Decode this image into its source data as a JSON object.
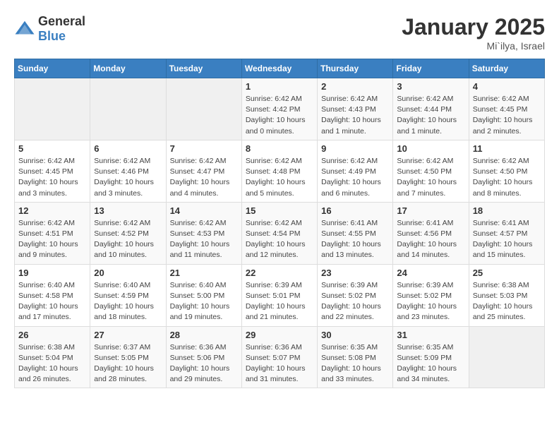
{
  "logo": {
    "general": "General",
    "blue": "Blue"
  },
  "header": {
    "title": "January 2025",
    "location": "Mi`ilya, Israel"
  },
  "weekdays": [
    "Sunday",
    "Monday",
    "Tuesday",
    "Wednesday",
    "Thursday",
    "Friday",
    "Saturday"
  ],
  "weeks": [
    [
      {
        "day": "",
        "info": ""
      },
      {
        "day": "",
        "info": ""
      },
      {
        "day": "",
        "info": ""
      },
      {
        "day": "1",
        "info": "Sunrise: 6:42 AM\nSunset: 4:42 PM\nDaylight: 10 hours\nand 0 minutes."
      },
      {
        "day": "2",
        "info": "Sunrise: 6:42 AM\nSunset: 4:43 PM\nDaylight: 10 hours\nand 1 minute."
      },
      {
        "day": "3",
        "info": "Sunrise: 6:42 AM\nSunset: 4:44 PM\nDaylight: 10 hours\nand 1 minute."
      },
      {
        "day": "4",
        "info": "Sunrise: 6:42 AM\nSunset: 4:45 PM\nDaylight: 10 hours\nand 2 minutes."
      }
    ],
    [
      {
        "day": "5",
        "info": "Sunrise: 6:42 AM\nSunset: 4:45 PM\nDaylight: 10 hours\nand 3 minutes."
      },
      {
        "day": "6",
        "info": "Sunrise: 6:42 AM\nSunset: 4:46 PM\nDaylight: 10 hours\nand 3 minutes."
      },
      {
        "day": "7",
        "info": "Sunrise: 6:42 AM\nSunset: 4:47 PM\nDaylight: 10 hours\nand 4 minutes."
      },
      {
        "day": "8",
        "info": "Sunrise: 6:42 AM\nSunset: 4:48 PM\nDaylight: 10 hours\nand 5 minutes."
      },
      {
        "day": "9",
        "info": "Sunrise: 6:42 AM\nSunset: 4:49 PM\nDaylight: 10 hours\nand 6 minutes."
      },
      {
        "day": "10",
        "info": "Sunrise: 6:42 AM\nSunset: 4:50 PM\nDaylight: 10 hours\nand 7 minutes."
      },
      {
        "day": "11",
        "info": "Sunrise: 6:42 AM\nSunset: 4:50 PM\nDaylight: 10 hours\nand 8 minutes."
      }
    ],
    [
      {
        "day": "12",
        "info": "Sunrise: 6:42 AM\nSunset: 4:51 PM\nDaylight: 10 hours\nand 9 minutes."
      },
      {
        "day": "13",
        "info": "Sunrise: 6:42 AM\nSunset: 4:52 PM\nDaylight: 10 hours\nand 10 minutes."
      },
      {
        "day": "14",
        "info": "Sunrise: 6:42 AM\nSunset: 4:53 PM\nDaylight: 10 hours\nand 11 minutes."
      },
      {
        "day": "15",
        "info": "Sunrise: 6:42 AM\nSunset: 4:54 PM\nDaylight: 10 hours\nand 12 minutes."
      },
      {
        "day": "16",
        "info": "Sunrise: 6:41 AM\nSunset: 4:55 PM\nDaylight: 10 hours\nand 13 minutes."
      },
      {
        "day": "17",
        "info": "Sunrise: 6:41 AM\nSunset: 4:56 PM\nDaylight: 10 hours\nand 14 minutes."
      },
      {
        "day": "18",
        "info": "Sunrise: 6:41 AM\nSunset: 4:57 PM\nDaylight: 10 hours\nand 15 minutes."
      }
    ],
    [
      {
        "day": "19",
        "info": "Sunrise: 6:40 AM\nSunset: 4:58 PM\nDaylight: 10 hours\nand 17 minutes."
      },
      {
        "day": "20",
        "info": "Sunrise: 6:40 AM\nSunset: 4:59 PM\nDaylight: 10 hours\nand 18 minutes."
      },
      {
        "day": "21",
        "info": "Sunrise: 6:40 AM\nSunset: 5:00 PM\nDaylight: 10 hours\nand 19 minutes."
      },
      {
        "day": "22",
        "info": "Sunrise: 6:39 AM\nSunset: 5:01 PM\nDaylight: 10 hours\nand 21 minutes."
      },
      {
        "day": "23",
        "info": "Sunrise: 6:39 AM\nSunset: 5:02 PM\nDaylight: 10 hours\nand 22 minutes."
      },
      {
        "day": "24",
        "info": "Sunrise: 6:39 AM\nSunset: 5:02 PM\nDaylight: 10 hours\nand 23 minutes."
      },
      {
        "day": "25",
        "info": "Sunrise: 6:38 AM\nSunset: 5:03 PM\nDaylight: 10 hours\nand 25 minutes."
      }
    ],
    [
      {
        "day": "26",
        "info": "Sunrise: 6:38 AM\nSunset: 5:04 PM\nDaylight: 10 hours\nand 26 minutes."
      },
      {
        "day": "27",
        "info": "Sunrise: 6:37 AM\nSunset: 5:05 PM\nDaylight: 10 hours\nand 28 minutes."
      },
      {
        "day": "28",
        "info": "Sunrise: 6:36 AM\nSunset: 5:06 PM\nDaylight: 10 hours\nand 29 minutes."
      },
      {
        "day": "29",
        "info": "Sunrise: 6:36 AM\nSunset: 5:07 PM\nDaylight: 10 hours\nand 31 minutes."
      },
      {
        "day": "30",
        "info": "Sunrise: 6:35 AM\nSunset: 5:08 PM\nDaylight: 10 hours\nand 33 minutes."
      },
      {
        "day": "31",
        "info": "Sunrise: 6:35 AM\nSunset: 5:09 PM\nDaylight: 10 hours\nand 34 minutes."
      },
      {
        "day": "",
        "info": ""
      }
    ]
  ]
}
